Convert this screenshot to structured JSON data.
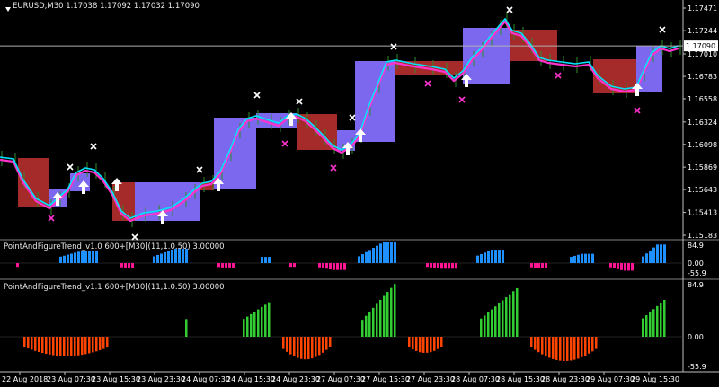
{
  "symbol_header": "EURUSD,M30  1.17038 1.17092 1.17032 1.17090",
  "current_price": "1.17090",
  "price_scale": [
    "1.17471",
    "1.17244",
    "1.17010",
    "1.16783",
    "1.16558",
    "1.16324",
    "1.16098",
    "1.15869",
    "1.15643",
    "1.15413",
    "1.15183"
  ],
  "indicator1": {
    "label": "PointAndFigureTrend_v1.0 600+[M30](11,1.0.50) 3.00000",
    "scale": [
      "84.9",
      "0.00",
      "-55.9"
    ]
  },
  "indicator2": {
    "label": "PointAndFigureTrend_v1.1 600+[M30](11,1.0.50) 3.00000",
    "scale": [
      "84.9",
      "0.00",
      "-55.9"
    ]
  },
  "time_axis": [
    "22 Aug 2018",
    "23 Aug 07:30",
    "23 Aug 15:30",
    "23 Aug 23:30",
    "24 Aug 07:30",
    "24 Aug 15:30",
    "24 Aug 23:30",
    "27 Aug 07:30",
    "27 Aug 15:30",
    "27 Aug 23:30",
    "28 Aug 07:30",
    "28 Aug 15:30",
    "28 Aug 23:30",
    "29 Aug 07:30",
    "29 Aug 15:30"
  ],
  "colors": {
    "background": "#000000",
    "bull_box": "#7b68ee",
    "bear_box": "#a52a2a",
    "fast_line": "#00e5ff",
    "slow_line": "#ff33cc",
    "up_arrow": "#ffffff",
    "x_marker_high": "#ffffff",
    "x_marker_low": "#ff33cc",
    "hist1_pos": "#1e90ff",
    "hist1_neg": "#ff1493",
    "hist2_pos": "#32cd32",
    "hist2_neg": "#ff4500",
    "axis": "#c0c0c0"
  },
  "icons": {
    "menu_arrow": "triangle-down-icon",
    "signal_arrow": "arrow-up-icon",
    "marker": "x-cross-icon"
  }
}
